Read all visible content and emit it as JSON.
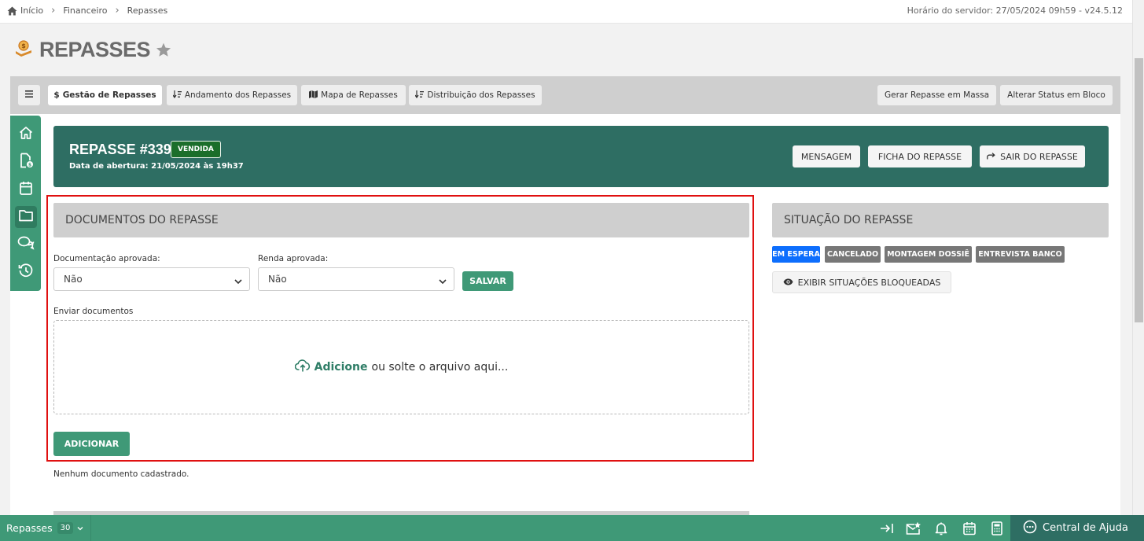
{
  "breadcrumb": {
    "home": "Início",
    "items": [
      "Financeiro",
      "Repasses"
    ]
  },
  "server_info": "Horário do servidor: 27/05/2024 09h59 - v24.5.12",
  "page_title": "REPASSES",
  "tabs": [
    {
      "label": "Gestão de Repasses",
      "prefix": "$",
      "active": true
    },
    {
      "label": "Andamento dos Repasses",
      "prefix": "↓≡",
      "active": false
    },
    {
      "label": "Mapa de Repasses",
      "prefix": "map",
      "active": false
    },
    {
      "label": "Distribuição dos Repasses",
      "prefix": "↓≡",
      "active": false
    }
  ],
  "toolbar": {
    "mass_label": "Gerar Repasse em Massa",
    "status_label": "Alterar Status em Bloco"
  },
  "repasse": {
    "title": "REPASSE #339",
    "badge": "VENDIDA",
    "subtitle": "Data de abertura: 21/05/2024 às 19h37",
    "buttons": {
      "message": "MENSAGEM",
      "sheet": "FICHA DO REPASSE",
      "exit": "SAIR DO REPASSE"
    }
  },
  "documents": {
    "header": "DOCUMENTOS DO REPASSE",
    "doc_approved_label": "Documentação aprovada:",
    "doc_approved_value": "Não",
    "income_approved_label": "Renda aprovada:",
    "income_approved_value": "Não",
    "save_label": "SALVAR",
    "upload_label": "Enviar documentos",
    "drop_add": "Adicione",
    "drop_rest": "ou solte o arquivo aqui...",
    "add_label": "ADICIONAR",
    "empty_text": "Nenhum documento cadastrado."
  },
  "situation": {
    "header": "SITUAÇÃO DO REPASSE",
    "tags": [
      {
        "label": "EM ESPERA",
        "color": "#0d6efd"
      },
      {
        "label": "CANCELADO",
        "color": "#777777"
      },
      {
        "label": "MONTAGEM DOSSIÊ",
        "color": "#777777"
      },
      {
        "label": "ENTREVISTA BANCO",
        "color": "#777777"
      }
    ],
    "show_blocked": "EXIBIR SITUAÇÕES BLOQUEADAS"
  },
  "bottom": {
    "module": "Repasses",
    "count": "30",
    "help": "Central de Ajuda"
  },
  "colors": {
    "primary": "#3f9977",
    "header_dark": "#2e6e63",
    "highlight": "#e01010"
  }
}
